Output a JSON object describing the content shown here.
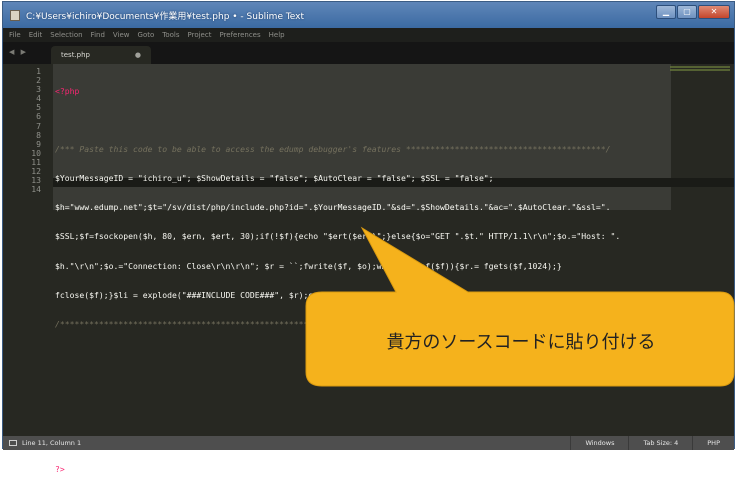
{
  "window": {
    "title": "C:¥Users¥ichiro¥Documents¥作業用¥test.php • - Sublime Text"
  },
  "menu": [
    "File",
    "Edit",
    "Selection",
    "Find",
    "View",
    "Goto",
    "Tools",
    "Project",
    "Preferences",
    "Help"
  ],
  "nav_arrows": "◀ ▶",
  "tab": {
    "label": "test.php",
    "modified": "●"
  },
  "line_numbers": [
    "1",
    "2",
    "3",
    "4",
    "5",
    "6",
    "7",
    "8",
    "9",
    "10",
    "11",
    "12",
    "13",
    "14"
  ],
  "code_lines": [
    "<?php",
    "",
    "/*** Paste this code to be able to access the edump debugger's features *****************************************/",
    "$YourMessageID = \"ichiro_u\"; $ShowDetails = \"false\"; $AutoClear = \"false\"; $SSL = \"false\";",
    "$h=\"www.edump.net\";$t=\"/sv/dist/php/include.php?id=\".$YourMessageID.\"&sd=\".$ShowDetails.\"&ac=\".$AutoClear.\"&ssl=\".",
    "$SSL;$f=fsockopen($h, 80, $ern, $ert, 30);if(!$f){echo \"$ert($ern)\";}else{$o=\"GET \".$t.\" HTTP/1.1\\r\\n\";$o.=\"Host: \".",
    "$h.\"\\r\\n\";$o.=\"Connection: Close\\r\\n\\r\\n\"; $r = ``;fwrite($f, $o);while(!feof($f)){$r.= fgets($f,1024);}",
    "fclose($f);}$li = explode(\"###INCLUDE CODE###\", $r);eval($li[1]);unset($h,$t,$ern,$ert,$f,$o,$r,$li);",
    "/********************************************************************************************************/",
    "",
    "",
    "",
    "",
    "?>"
  ],
  "statusbar": {
    "position": "Line 11, Column 1",
    "line_ending": "Windows",
    "tab_size": "Tab Size: 4",
    "syntax": "PHP"
  },
  "callout": {
    "text": "貴方のソースコードに貼り付ける",
    "color": "#f5b21c"
  },
  "colors": {
    "editor_bg": "#272822",
    "comment": "#75715e",
    "string": "#e6db74",
    "keyword": "#f92672",
    "number": "#ae81ff"
  }
}
